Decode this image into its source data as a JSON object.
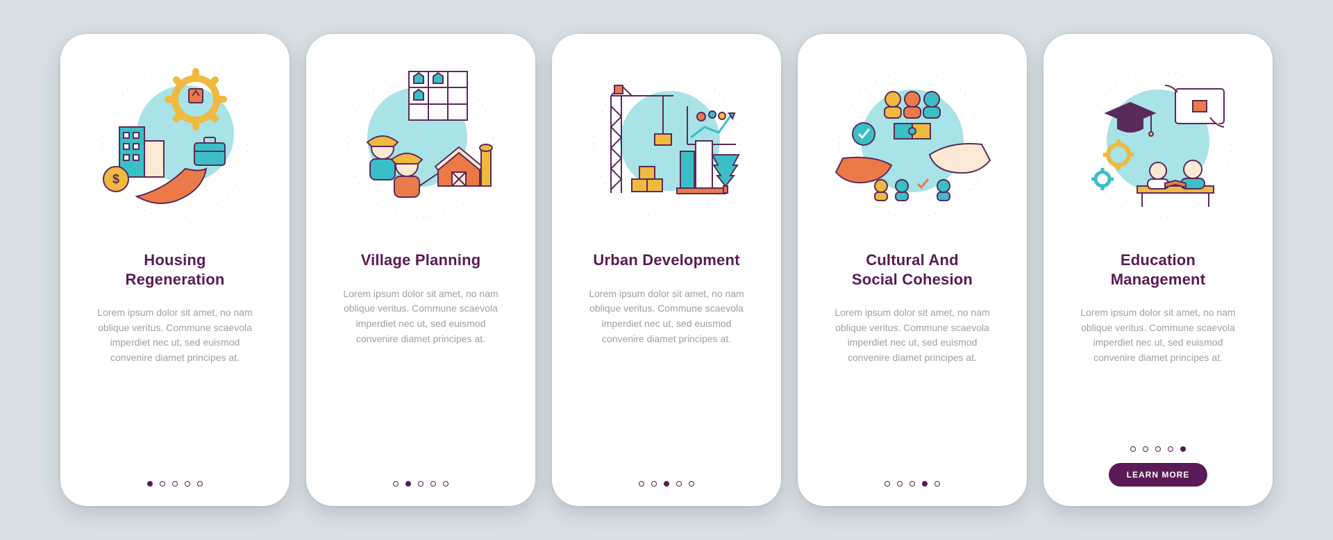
{
  "colors": {
    "background": "#d8e0e5",
    "card": "#ffffff",
    "title": "#5a1a55",
    "body": "#9aa0a8",
    "accent_teal": "#3bbfc6",
    "accent_orange": "#ec7a49",
    "accent_yellow": "#f0b93f",
    "accent_purple": "#5a2a5a"
  },
  "cards": [
    {
      "title": "Housing\nRegeneration",
      "body": "Lorem ipsum dolor sit amet, no nam oblique veritus. Commune scaevola imperdiet nec ut, sed euismod convenire diamet principes at.",
      "icon": "housing-icon",
      "activeDot": 0
    },
    {
      "title": "Village Planning",
      "body": "Lorem ipsum dolor sit amet, no nam oblique veritus. Commune scaevola imperdiet nec ut, sed euismod convenire diamet principes at.",
      "icon": "village-icon",
      "activeDot": 1
    },
    {
      "title": "Urban Development",
      "body": "Lorem ipsum dolor sit amet, no nam oblique veritus. Commune scaevola imperdiet nec ut, sed euismod convenire diamet principes at.",
      "icon": "urban-icon",
      "activeDot": 2
    },
    {
      "title": "Cultural And\nSocial Cohesion",
      "body": "Lorem ipsum dolor sit amet, no nam oblique veritus. Commune scaevola imperdiet nec ut, sed euismod convenire diamet principes at.",
      "icon": "cohesion-icon",
      "activeDot": 3
    },
    {
      "title": "Education\nManagement",
      "body": "Lorem ipsum dolor sit amet, no nam oblique veritus. Commune scaevola imperdiet nec ut, sed euismod convenire diamet principes at.",
      "icon": "education-icon",
      "activeDot": 4,
      "cta": "LEARN MORE"
    }
  ],
  "dotCount": 5
}
